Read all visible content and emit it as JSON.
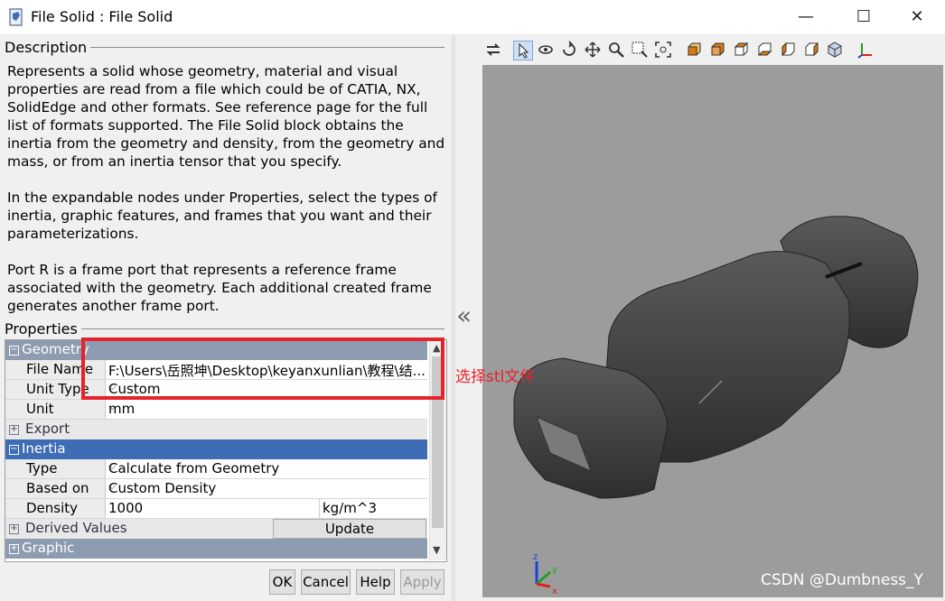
{
  "window": {
    "title": "File Solid : File Solid",
    "minimize": "—",
    "maximize": "☐",
    "close": "✕"
  },
  "description": {
    "label": "Description",
    "paragraphs": [
      "Represents a solid whose geometry, material and visual properties are read from a file which could be of CATIA, NX, SolidEdge and other formats. See reference page for the full list of formats supported. The File Solid block obtains the inertia from the geometry and density, from the geometry and mass, or from an inertia tensor that you specify.",
      "In the expandable nodes under Properties, select the types of inertia, graphic features, and frames that you want and their parameterizations.",
      "Port R is a frame port that represents a reference frame associated with the geometry. Each additional created frame generates another frame port."
    ]
  },
  "properties": {
    "label": "Properties",
    "geometry": {
      "label": "Geometry",
      "file_name_label": "File Name",
      "file_name_value": "F:\\Users\\岳照坤\\Desktop\\keyanxunlian\\教程\\结...",
      "unit_type_label": "Unit Type",
      "unit_type_value": "Custom",
      "unit_label": "Unit",
      "unit_value": "mm",
      "export_label": "Export"
    },
    "inertia": {
      "label": "Inertia",
      "type_label": "Type",
      "type_value": "Calculate from Geometry",
      "based_on_label": "Based on",
      "based_on_value": "Custom Density",
      "density_label": "Density",
      "density_value": "1000",
      "density_unit": "kg/m^3",
      "derived_label": "Derived Values",
      "update_label": "Update"
    },
    "graphic": {
      "label": "Graphic"
    }
  },
  "buttons": {
    "ok": "OK",
    "cancel": "Cancel",
    "help": "Help",
    "apply": "Apply"
  },
  "viewer": {
    "collapse_glyph": "«",
    "axis_labels": {
      "z": "z",
      "y": "y",
      "x": "x"
    }
  },
  "annotation": {
    "text": "选择stl文件",
    "color": "#e8222a"
  },
  "watermark": "CSDN @Dumbness_Y",
  "colors": {
    "category_header": "#8d9cb0",
    "selected_header": "#3f6db5",
    "canvas_bg": "#9c9c9c"
  }
}
